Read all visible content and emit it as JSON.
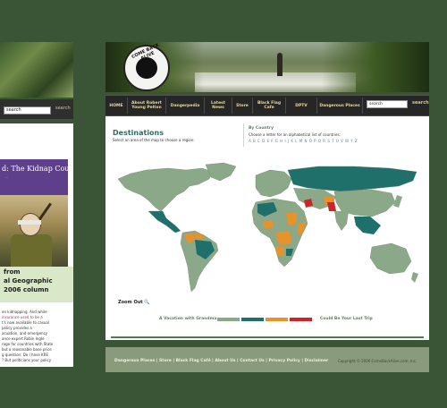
{
  "left_page": {
    "search_placeholder": "search",
    "search_button": "search",
    "kidnap_title": "d: The Kidnap Course",
    "kidnap_sub": "...",
    "nat_geo_lines": [
      "from",
      "al Geographic",
      "2006 column"
    ],
    "body_lines": [
      "en kidnapping. And while",
      "insurance used to be a",
      "t's now available to casual",
      "policy provides a",
      "acuation, and emergency",
      "ance expert Robin Ingle",
      "rage for countries with State",
      "but a reasonable base price",
      "g question: Do I have KRE",
      "? But politicians your policy"
    ]
  },
  "header": {
    "logo_text": "COME BACK ALIVE"
  },
  "nav": {
    "items": [
      "HOME",
      "About Robert Young Pelton",
      "Dangerpedia",
      "Latest News",
      "Store",
      "Black Flag Cafe",
      "DPTV",
      "Dangerous Places"
    ],
    "search_placeholder": "search",
    "search_button": "search"
  },
  "destinations": {
    "title": "Destinations",
    "subtitle": "Select an area of the map to choose a region:",
    "by_country": "By Country",
    "choose_letter": "Choose a letter for an alphabetical list of countries:",
    "alphabet": "A B C D E F G H I J K L M N O P Q R S T U V W Y Z",
    "zoom_out": "Zoom Out",
    "legend_left": "A Vacation with Grandma",
    "legend_right": "Could Be Your Last Trip",
    "legend_colors": [
      "#8ba889",
      "#1f6f6a",
      "#e8922a",
      "#c8262b"
    ]
  },
  "footer": {
    "links": "Dangerous Places | Store | Black Flag Café | About Us | Contact Us | Privacy Policy | Disclaimer",
    "copyright": "Copyright © 2006 ComeBackAlive.com, Inc."
  }
}
